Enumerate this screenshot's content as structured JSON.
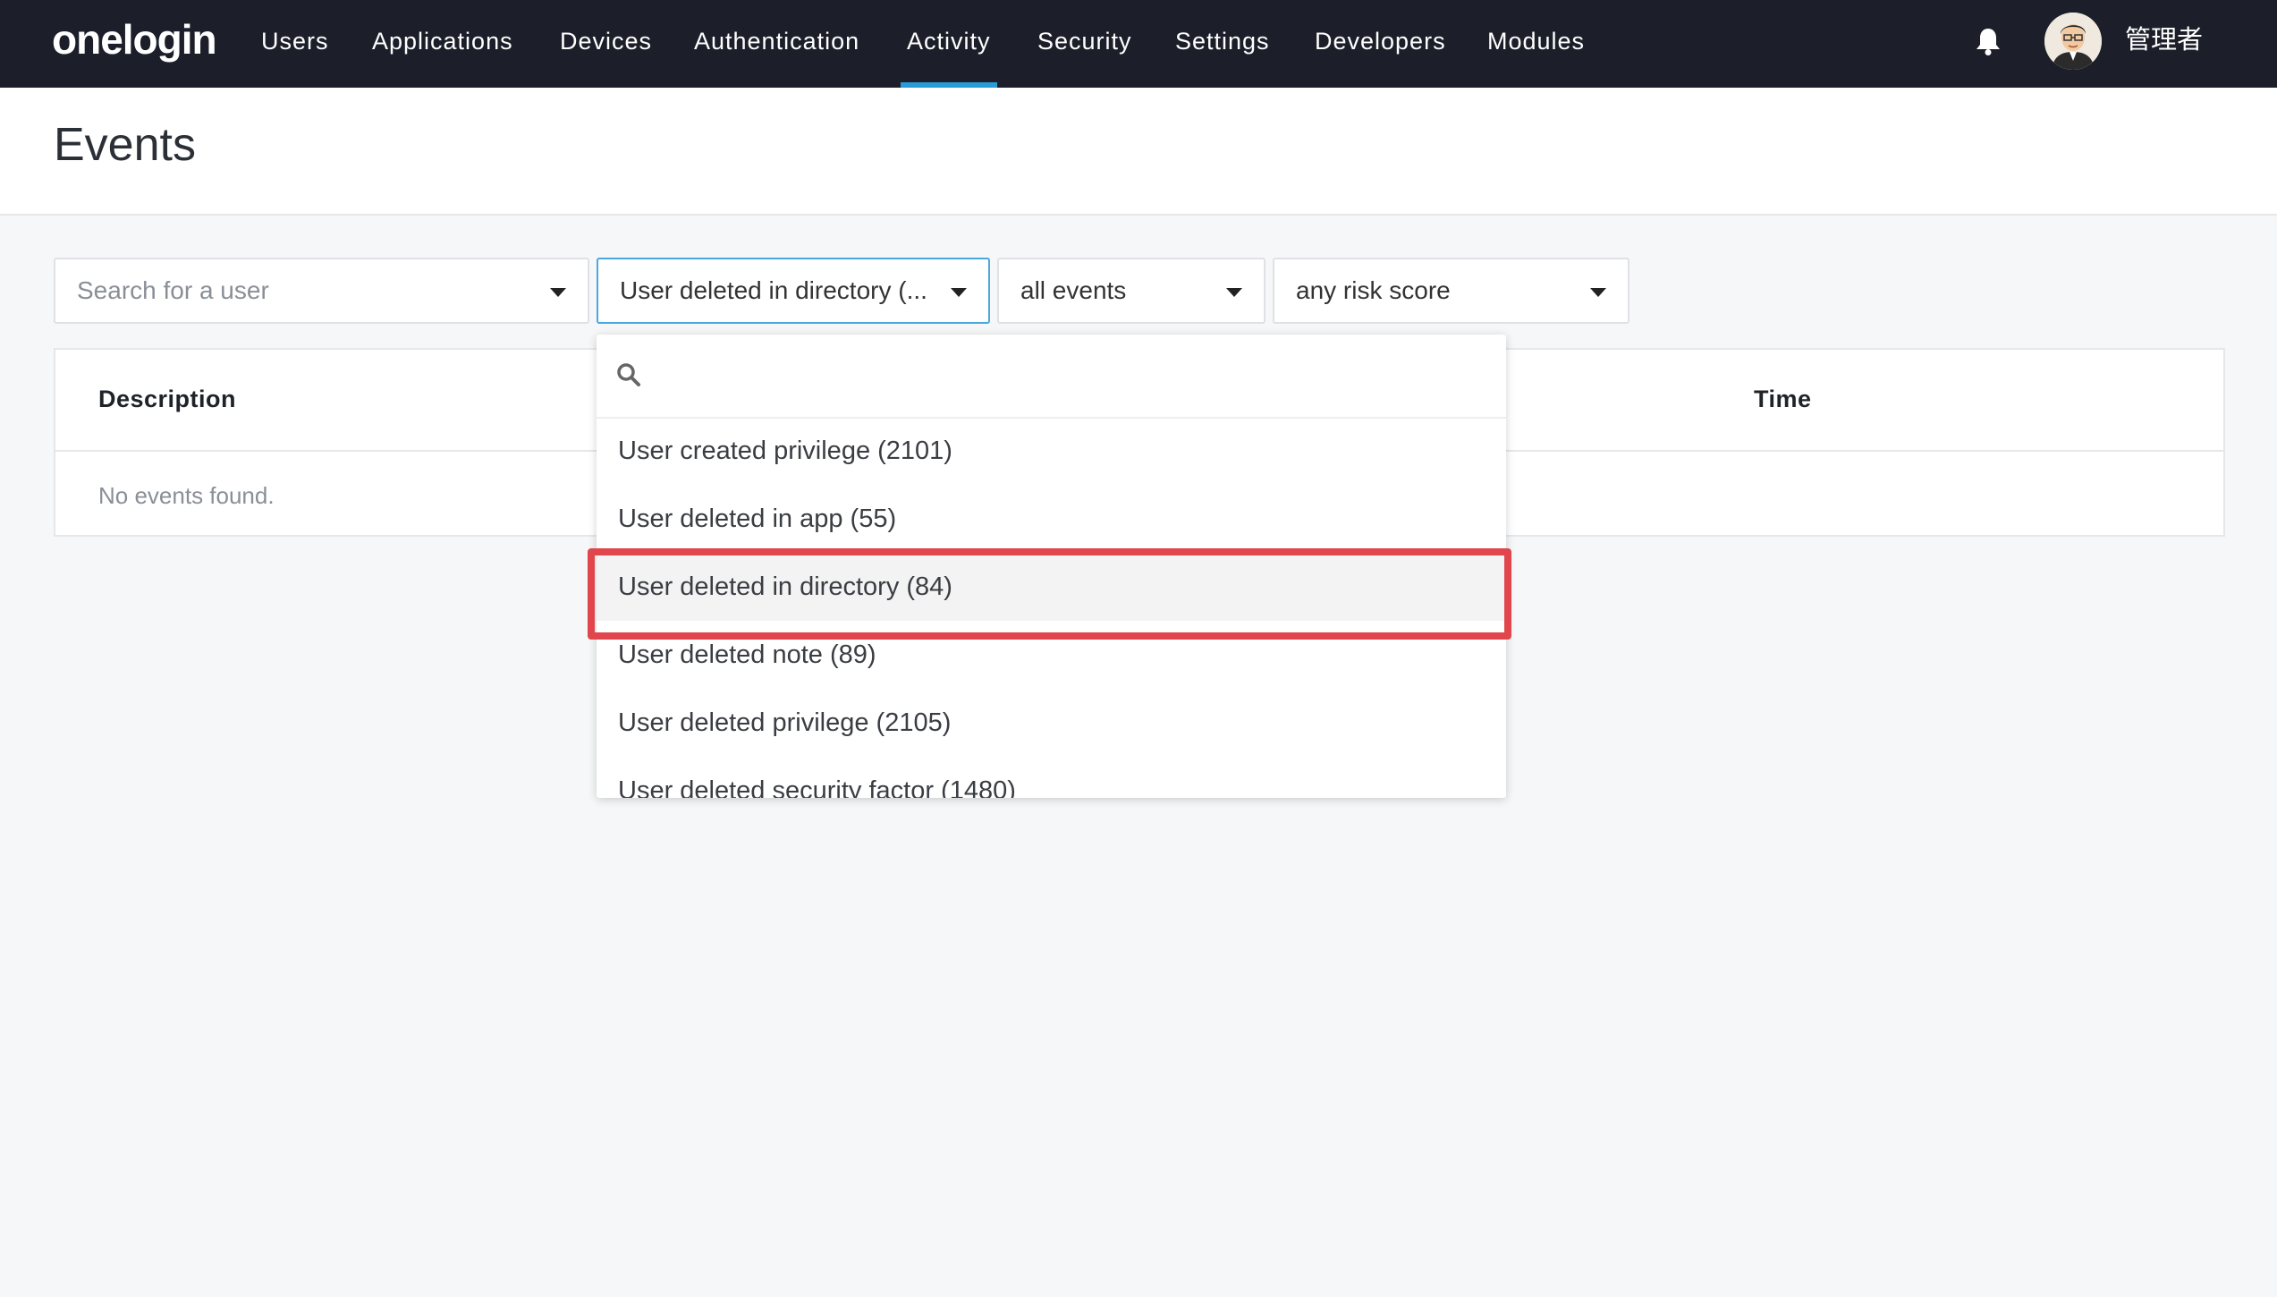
{
  "brand": {
    "logo_text": "onelogin"
  },
  "nav": {
    "items": [
      "Users",
      "Applications",
      "Devices",
      "Authentication",
      "Activity",
      "Security",
      "Settings",
      "Developers",
      "Modules"
    ],
    "active": "Activity"
  },
  "header_right": {
    "user_name": "管理者",
    "bell_icon": "bell-icon"
  },
  "page": {
    "title": "Events"
  },
  "filters": {
    "user": {
      "placeholder": "Search for a user"
    },
    "event_type": {
      "value": "User deleted in directory (..."
    },
    "scope": {
      "value": "all events"
    },
    "risk": {
      "value": "any risk score"
    }
  },
  "table": {
    "columns": [
      "Description",
      "Time"
    ],
    "empty_message": "No events found."
  },
  "dropdown": {
    "search_placeholder": "",
    "options": [
      "User created privilege (2101)",
      "User deleted in app (55)",
      "User deleted in directory (84)",
      "User deleted note (89)",
      "User deleted privilege (2105)",
      "User deleted security factor (1480)"
    ],
    "highlighted": "User deleted in directory (84)"
  },
  "colors": {
    "nav_bg": "#1c1f2a",
    "accent": "#2a9bd7",
    "highlight": "#e0464b",
    "page_bg": "#f6f7f8"
  }
}
